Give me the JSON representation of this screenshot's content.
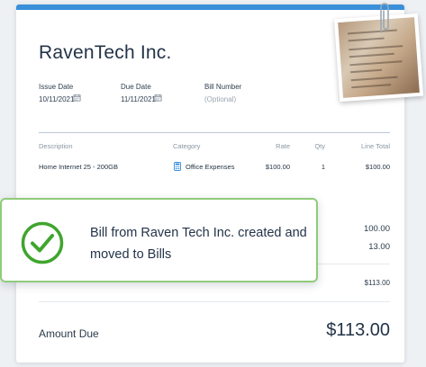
{
  "bill": {
    "vendor_name": "RavenTech Inc.",
    "issue_date_label": "Issue Date",
    "issue_date_value": "10/11/2021",
    "due_date_label": "Due Date",
    "due_date_value": "11/11/2021",
    "bill_number_label": "Bill Number",
    "bill_number_placeholder": "(Optional)",
    "icons": {
      "date": "calendar-icon",
      "category": "calculator-icon"
    },
    "columns": {
      "description": "Description",
      "category": "Category",
      "rate": "Rate",
      "qty": "Qty",
      "line_total": "Line Total"
    },
    "line_items": [
      {
        "description": "Home Internet 25 - 200GB",
        "category": "Office Expenses",
        "rate": "$100.00",
        "qty": "1",
        "line_total": "$100.00"
      }
    ],
    "summary": {
      "subtotal": "100.00",
      "tax": "13.00",
      "total": "$113.00"
    },
    "amount_due_label": "Amount Due",
    "amount_due_value": "$113.00"
  },
  "toast": {
    "message": "Bill from Raven Tech Inc. created and moved to Bills",
    "icon": "check-circle-icon",
    "accent_color": "#3fa52d"
  },
  "colors": {
    "accent": "#3a8fd9",
    "success": "#3fa52d"
  }
}
